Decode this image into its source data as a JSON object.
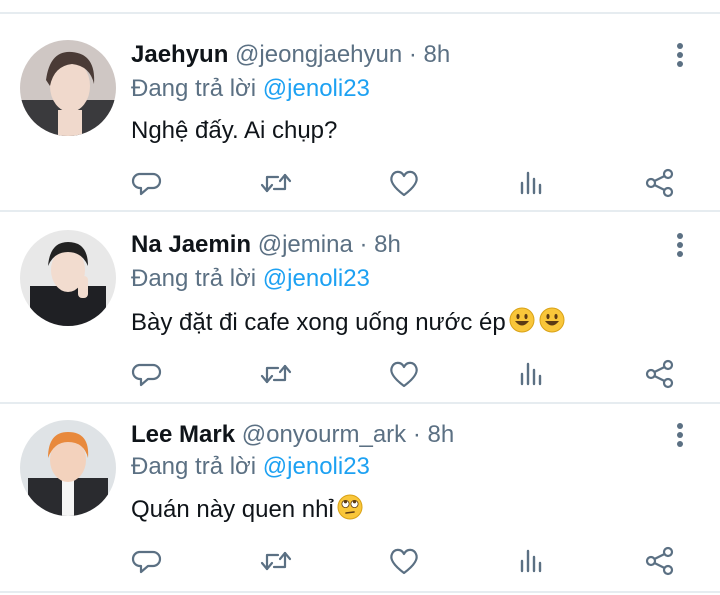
{
  "tweets": [
    {
      "name": "Jaehyun",
      "handle": "@jeongjaehyun",
      "dot": "·",
      "time": "8h",
      "reply_prefix": "Đang trả lời",
      "reply_to": "@jenoli23",
      "text": "Nghệ đấy. Ai chụp?",
      "emojis": []
    },
    {
      "name": "Na Jaemin",
      "handle": "@jemina",
      "dot": "·",
      "time": "8h",
      "reply_prefix": "Đang trả lời",
      "reply_to": "@jenoli23",
      "text": "Bày đặt đi cafe xong uống nước ép",
      "emojis": [
        "grinning-face",
        "grinning-face"
      ]
    },
    {
      "name": "Lee Mark",
      "handle": "@onyourm_ark",
      "dot": "·",
      "time": "8h",
      "reply_prefix": "Đang trả lời",
      "reply_to": "@jenoli23",
      "text": "Quán này quen nhỉ",
      "emojis": [
        "rolling-eyes-face"
      ]
    }
  ],
  "icons": {
    "reply": "reply-icon",
    "retweet": "retweet-icon",
    "like": "like-icon",
    "analytics": "analytics-icon",
    "share": "share-icon",
    "more": "more-vertical-icon"
  },
  "colors": {
    "text": "#0f1419",
    "secondary": "#5b7083",
    "accent": "#1da1f2",
    "divider": "#e6ecf0"
  }
}
